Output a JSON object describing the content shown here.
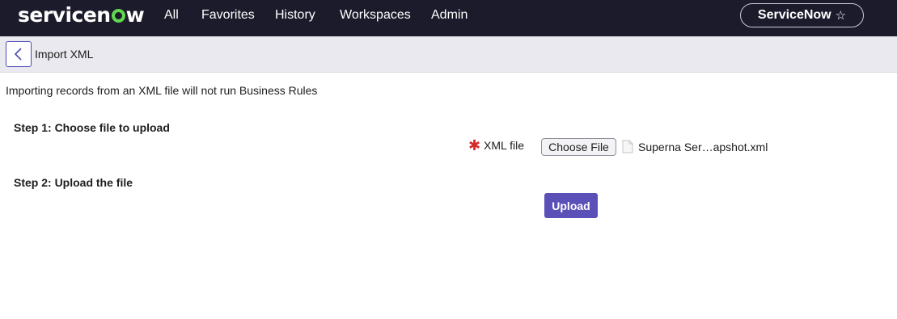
{
  "nav": {
    "brand": "servicenow",
    "items": [
      "All",
      "Favorites",
      "History",
      "Workspaces",
      "Admin"
    ],
    "instance": {
      "label": "ServiceNow",
      "icon": "star-icon"
    }
  },
  "header": {
    "back_icon": "chevron-left-icon",
    "title": "Import XML"
  },
  "form": {
    "notice": "Importing records from an XML file will not run Business Rules",
    "step1": "Step 1: Choose file to upload",
    "step2": "Step 2: Upload the file",
    "required_marker": "✱",
    "field_label": "XML file",
    "choose_button": "Choose File",
    "file_name": "Superna Ser…apshot.xml",
    "upload_button": "Upload"
  },
  "colors": {
    "topbar": "#1c1b2b",
    "logo_accent": "#62d84e",
    "upload_button": "#5b4fb8",
    "required": "#d52a2a"
  }
}
